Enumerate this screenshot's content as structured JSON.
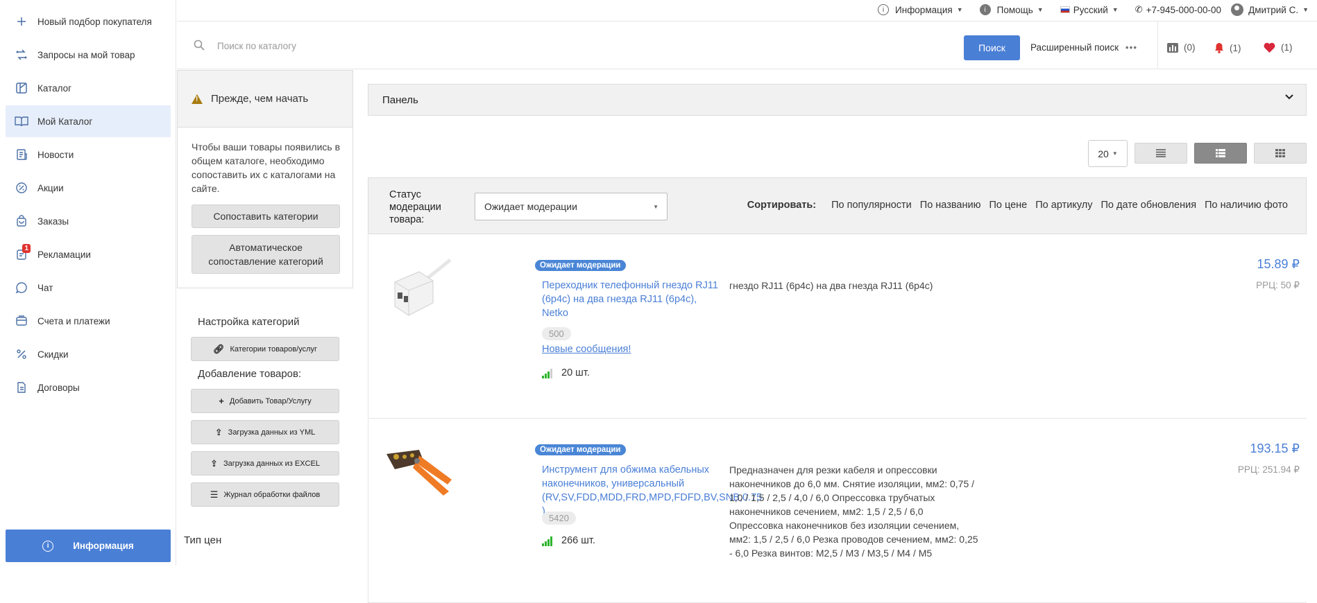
{
  "sidebar": {
    "items": [
      {
        "label": "Новый подбор покупателя",
        "icon": "plus-icon"
      },
      {
        "label": "Запросы на мой товар",
        "icon": "swap-icon"
      },
      {
        "label": "Каталог",
        "icon": "catalog-icon"
      },
      {
        "label": "Мой Каталог",
        "icon": "book-icon"
      },
      {
        "label": "Новости",
        "icon": "news-icon"
      },
      {
        "label": "Акции",
        "icon": "percent-badge-icon"
      },
      {
        "label": "Заказы",
        "icon": "bag-icon"
      },
      {
        "label": "Рекламации",
        "icon": "claims-icon",
        "badge": "1"
      },
      {
        "label": "Чат",
        "icon": "chat-icon"
      },
      {
        "label": "Счета и платежи",
        "icon": "invoice-icon"
      },
      {
        "label": "Скидки",
        "icon": "percent-icon"
      },
      {
        "label": "Договоры",
        "icon": "contract-icon"
      }
    ],
    "info_button": "Информация"
  },
  "topbar": {
    "info": "Информация",
    "help": "Помощь",
    "language": "Русский",
    "phone": "+7-945-000-00-00",
    "user": "Дмитрий С."
  },
  "search": {
    "placeholder": "Поиск по каталогу",
    "button": "Поиск",
    "advanced": "Расширенный поиск",
    "compare_count": "(0)",
    "notifications_count": "(1)",
    "favorites_count": "(1)"
  },
  "left_panel": {
    "before_title": "Прежде, чем начать",
    "before_text": "Чтобы ваши товары появились в общем каталоге, необходимо сопоставить их с каталогами на сайте.",
    "match_categories": "Сопоставить категории",
    "auto_match": "Автоматическое сопоставление категорий",
    "category_settings": "Настройка категорий",
    "categories_button": "Категории товаров/услуг",
    "add_products": "Добавление товаров:",
    "add_product_button": "Добавить Товар/Услугу",
    "upload_yml": "Загрузка данных из YML",
    "upload_excel": "Загрузка данных из EXCEL",
    "files_log": "Журнал обработки файлов",
    "price_type": "Тип цен"
  },
  "main": {
    "panel_label": "Панель",
    "per_page": "20",
    "status_label": "Статус модерации товара:",
    "status_value": "Ожидает модерации",
    "sort_label": "Сортировать:",
    "sort_options": [
      "По популярности",
      "По названию",
      "По цене",
      "По артикулу",
      "По дате обновления",
      "По наличию фото"
    ]
  },
  "products": [
    {
      "badge": "Ожидает модерации",
      "title": "Переходник телефонный гнездо RJ11 (6р4с) на два гнезда RJ11 (6р4с), Netko",
      "description": "гнездо RJ11 (6р4с) на два гнезда RJ11 (6р4с)",
      "code": "500",
      "messages": "Новые сообщения!",
      "stock": "20 шт.",
      "stock_level": 3,
      "price": "15.89 ₽",
      "rrc": "РРЦ: 50 ₽"
    },
    {
      "badge": "Ожидает модерации",
      "title": "Инструмент для обжима кабельных наконечников, универсальный (RV,SV,FDD,MDD,FRD,MPD,FDFD,BV,SNB,0.75 )",
      "description": "Предназначен для резки кабеля и опрессовки наконечников до 6,0 мм. Снятие изоляции, мм2: 0,75 / 1,0 / 1,5 / 2,5 / 4,0 / 6,0 Опрессовка трубчатых наконечников сечением, мм2: 1,5 / 2,5 / 6,0 Опрессовка наконечников без изоляции сечением, мм2: 1,5 / 2,5 / 6,0 Резка проводов сечением, мм2: 0,25 - 6,0 Резка винтов: М2,5 / М3 / М3,5 / М4 / М5",
      "code": "5420",
      "stock": "266 шт.",
      "stock_level": 4,
      "price": "193.15 ₽",
      "rrc": "РРЦ: 251.94 ₽"
    }
  ],
  "colors": {
    "accent": "#4a7fd6",
    "badge": "#4a86d6",
    "stock": "#2eb52e",
    "alert": "#e0322f"
  }
}
